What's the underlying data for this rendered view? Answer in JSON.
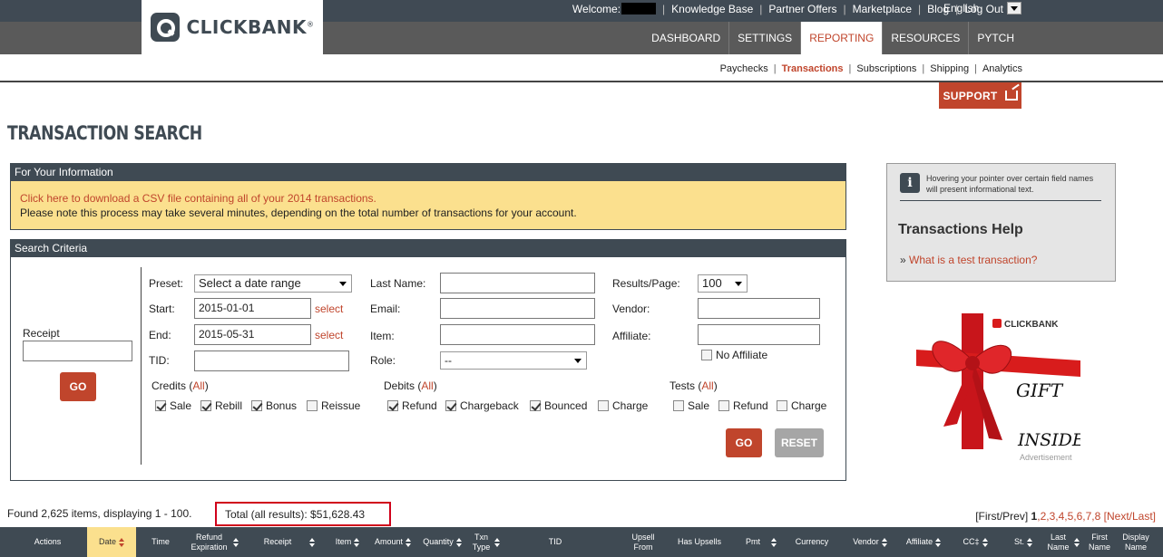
{
  "header": {
    "logo_text": "CLICKBANK",
    "welcome": "Welcome:",
    "top_links": [
      "Knowledge Base",
      "Partner Offers",
      "Marketplace",
      "Blog",
      "Log Out"
    ],
    "language": "English",
    "main_nav": [
      "DASHBOARD",
      "SETTINGS",
      "REPORTING",
      "RESOURCES",
      "PYTCH"
    ],
    "main_nav_active": "REPORTING",
    "sub_nav": [
      "Paychecks",
      "Transactions",
      "Subscriptions",
      "Shipping",
      "Analytics"
    ],
    "sub_nav_active": "Transactions",
    "support_label": "SUPPORT"
  },
  "page_title": "TRANSACTION SEARCH",
  "info_panel": {
    "title": "For Your Information",
    "csv_link": "Click here to download a CSV file containing all of your 2014 transactions.",
    "note": "Please note this process may take several minutes, depending on the total number of transactions for your account."
  },
  "search": {
    "title": "Search Criteria",
    "receipt_label": "Receipt",
    "receipt_value": "",
    "receipt_go": "GO",
    "preset_label": "Preset:",
    "preset_value": "Select a date range",
    "start_label": "Start:",
    "start_value": "2015-01-01",
    "end_label": "End:",
    "end_value": "2015-05-31",
    "select_link": "select",
    "tid_label": "TID:",
    "tid_value": "",
    "last_name_label": "Last Name:",
    "email_label": "Email:",
    "item_label": "Item:",
    "role_label": "Role:",
    "role_value": "--",
    "results_label": "Results/Page:",
    "results_value": "100",
    "vendor_label": "Vendor:",
    "affiliate_label": "Affiliate:",
    "no_affiliate": "No Affiliate",
    "credits_label": "Credits",
    "debits_label": "Debits",
    "tests_label": "Tests",
    "all_link": "All",
    "credits": [
      {
        "label": "Sale",
        "checked": true
      },
      {
        "label": "Rebill",
        "checked": true
      },
      {
        "label": "Bonus",
        "checked": true
      },
      {
        "label": "Reissue",
        "checked": false
      }
    ],
    "debits": [
      {
        "label": "Refund",
        "checked": true
      },
      {
        "label": "Chargeback",
        "checked": true
      },
      {
        "label": "Bounced",
        "checked": true
      },
      {
        "label": "Charge",
        "checked": false
      }
    ],
    "tests": [
      {
        "label": "Sale",
        "checked": false
      },
      {
        "label": "Refund",
        "checked": false
      },
      {
        "label": "Charge",
        "checked": false
      }
    ],
    "go_label": "GO",
    "reset_label": "RESET"
  },
  "help": {
    "note": "Hovering your pointer over certain field names will present informational text.",
    "title": "Transactions Help",
    "bullet": "»",
    "link": "What is a test transaction?"
  },
  "ad": {
    "brand": "CLICKBANK",
    "line1": "GIFT",
    "line2": "INSIDE",
    "caption": "Advertisement",
    "ribbon_color": "#d81c1c"
  },
  "results": {
    "found": "Found 2,625 items, displaying 1 - 100.",
    "total": "Total (all results): $51,628.43",
    "pager_first": "[First/Prev]",
    "pager_current": "1",
    "pager_pages": ",2,3,4,5,6,7,8",
    "pager_next": "[Next/Last]"
  },
  "table_headers": [
    "Actions",
    "Date",
    "Time",
    "Refund Expiration",
    "Receipt",
    "Item",
    "Amount",
    "Quantity",
    "Txn Type",
    "TID",
    "Upsell From",
    "Has Upsells",
    "Pmt",
    "Currency",
    "Vendor",
    "Affiliate",
    "CC‡",
    "St.",
    "Last Name",
    "First Name",
    "Display Name"
  ],
  "colors": {
    "brand_dark": "#3f4a53",
    "accent": "#c0452c",
    "info_bg": "#fbe08e"
  }
}
